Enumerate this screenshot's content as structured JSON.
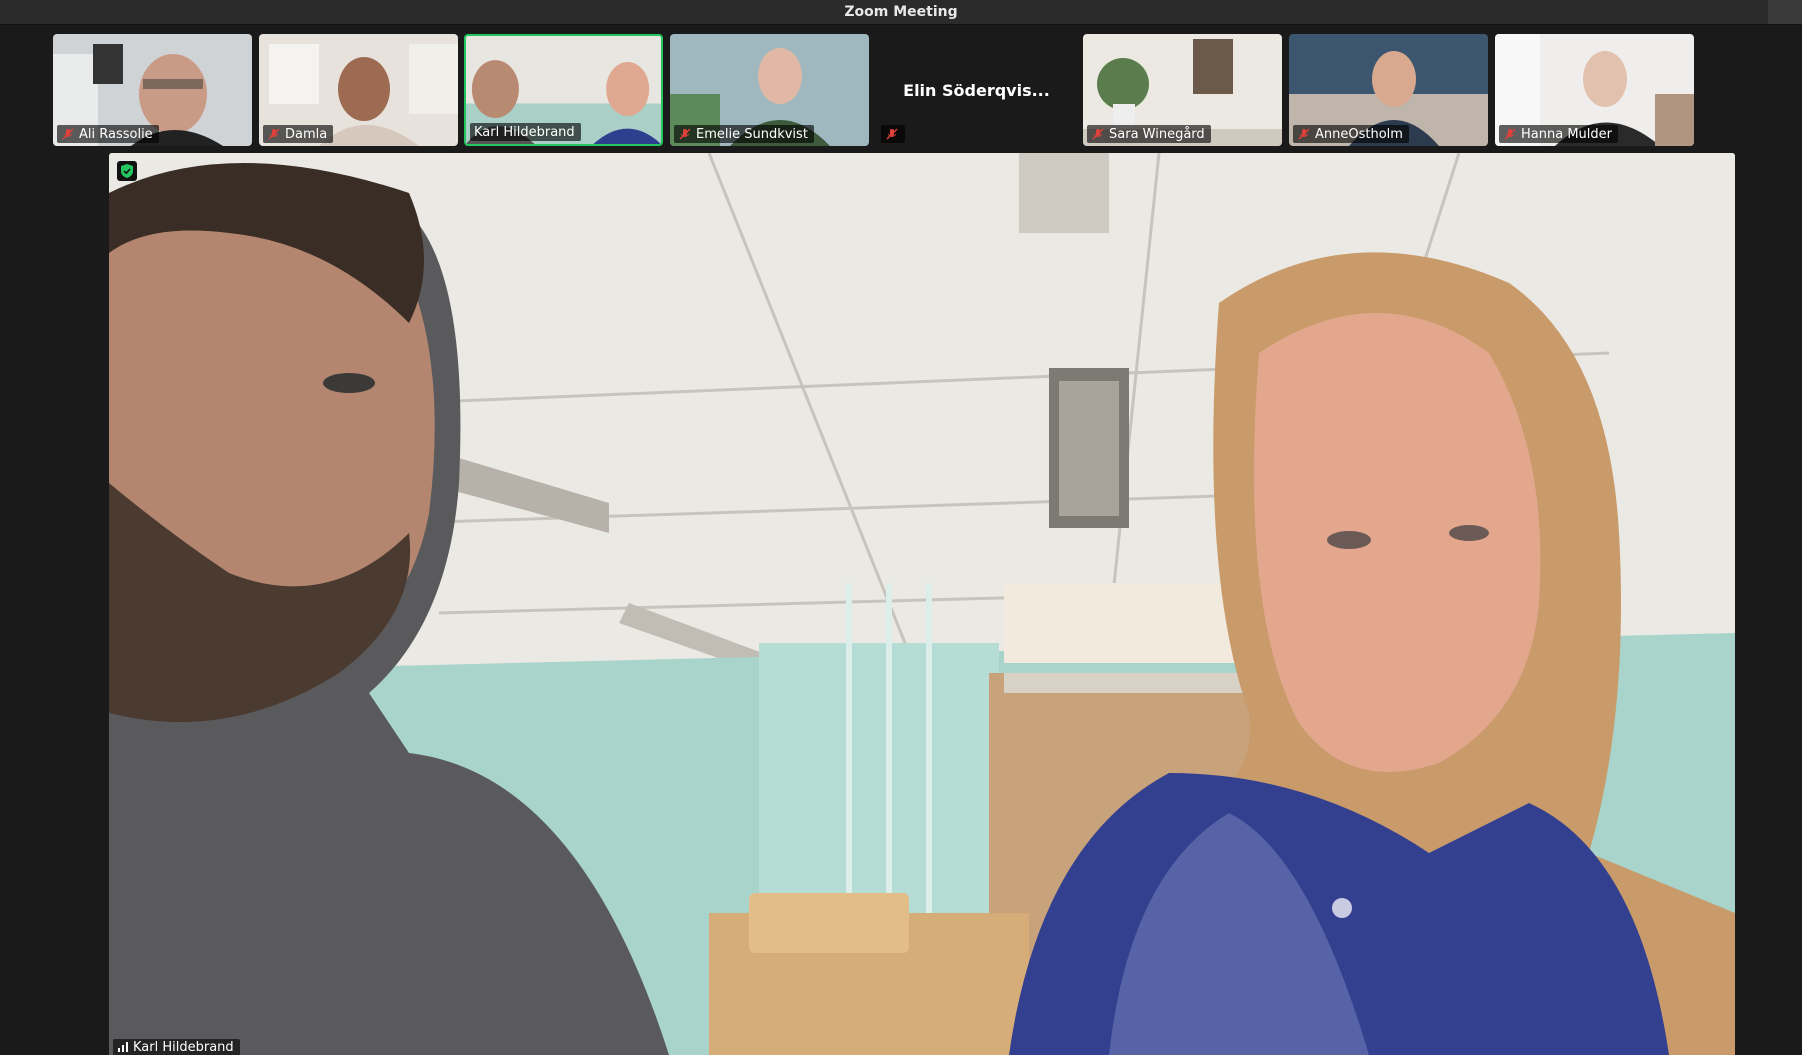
{
  "window": {
    "title": "Zoom Meeting"
  },
  "participants": [
    {
      "name": "Ali Rassolie",
      "muted": true,
      "video": true,
      "active": false
    },
    {
      "name": "Damla",
      "muted": true,
      "video": true,
      "active": false
    },
    {
      "name": "Karl Hildebrand",
      "muted": false,
      "video": true,
      "active": true
    },
    {
      "name": "Emelie Sundkvist",
      "muted": true,
      "video": true,
      "active": false
    },
    {
      "name": "Elin Söderqvis...",
      "muted": true,
      "video": false,
      "active": false
    },
    {
      "name": "Sara Winegård",
      "muted": true,
      "video": true,
      "active": false
    },
    {
      "name": "AnneOstholm",
      "muted": true,
      "video": true,
      "active": false
    },
    {
      "name": "Hanna Mulder",
      "muted": true,
      "video": true,
      "active": false
    }
  ],
  "main_speaker": {
    "name": "Karl Hildebrand"
  },
  "colors": {
    "active_border": "#22c55e",
    "mute_red": "#e0413a",
    "shield_green": "#22c55e"
  }
}
